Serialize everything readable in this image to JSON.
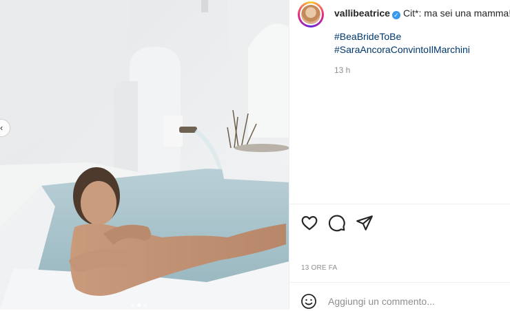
{
  "post": {
    "username": "vallibeatrice",
    "verified": true,
    "caption": "Cit*: ma sei una mamma!",
    "hashtags": [
      "#BeaBrideToBe",
      "#SaraAncoraConvintoIlMarchini"
    ],
    "caption_time": "13 h",
    "timestamp": "13 ORE FA"
  },
  "comment": {
    "placeholder": "Aggiungi un commento..."
  },
  "icons": {
    "like": "heart-icon",
    "comment": "comment-bubble-icon",
    "share": "paper-plane-icon",
    "emoji": "smiley-icon",
    "prev": "chevron-left-icon"
  },
  "colors": {
    "link": "#00376b",
    "text": "#262626",
    "muted": "#8e8e8e",
    "verified": "#3897f0"
  }
}
